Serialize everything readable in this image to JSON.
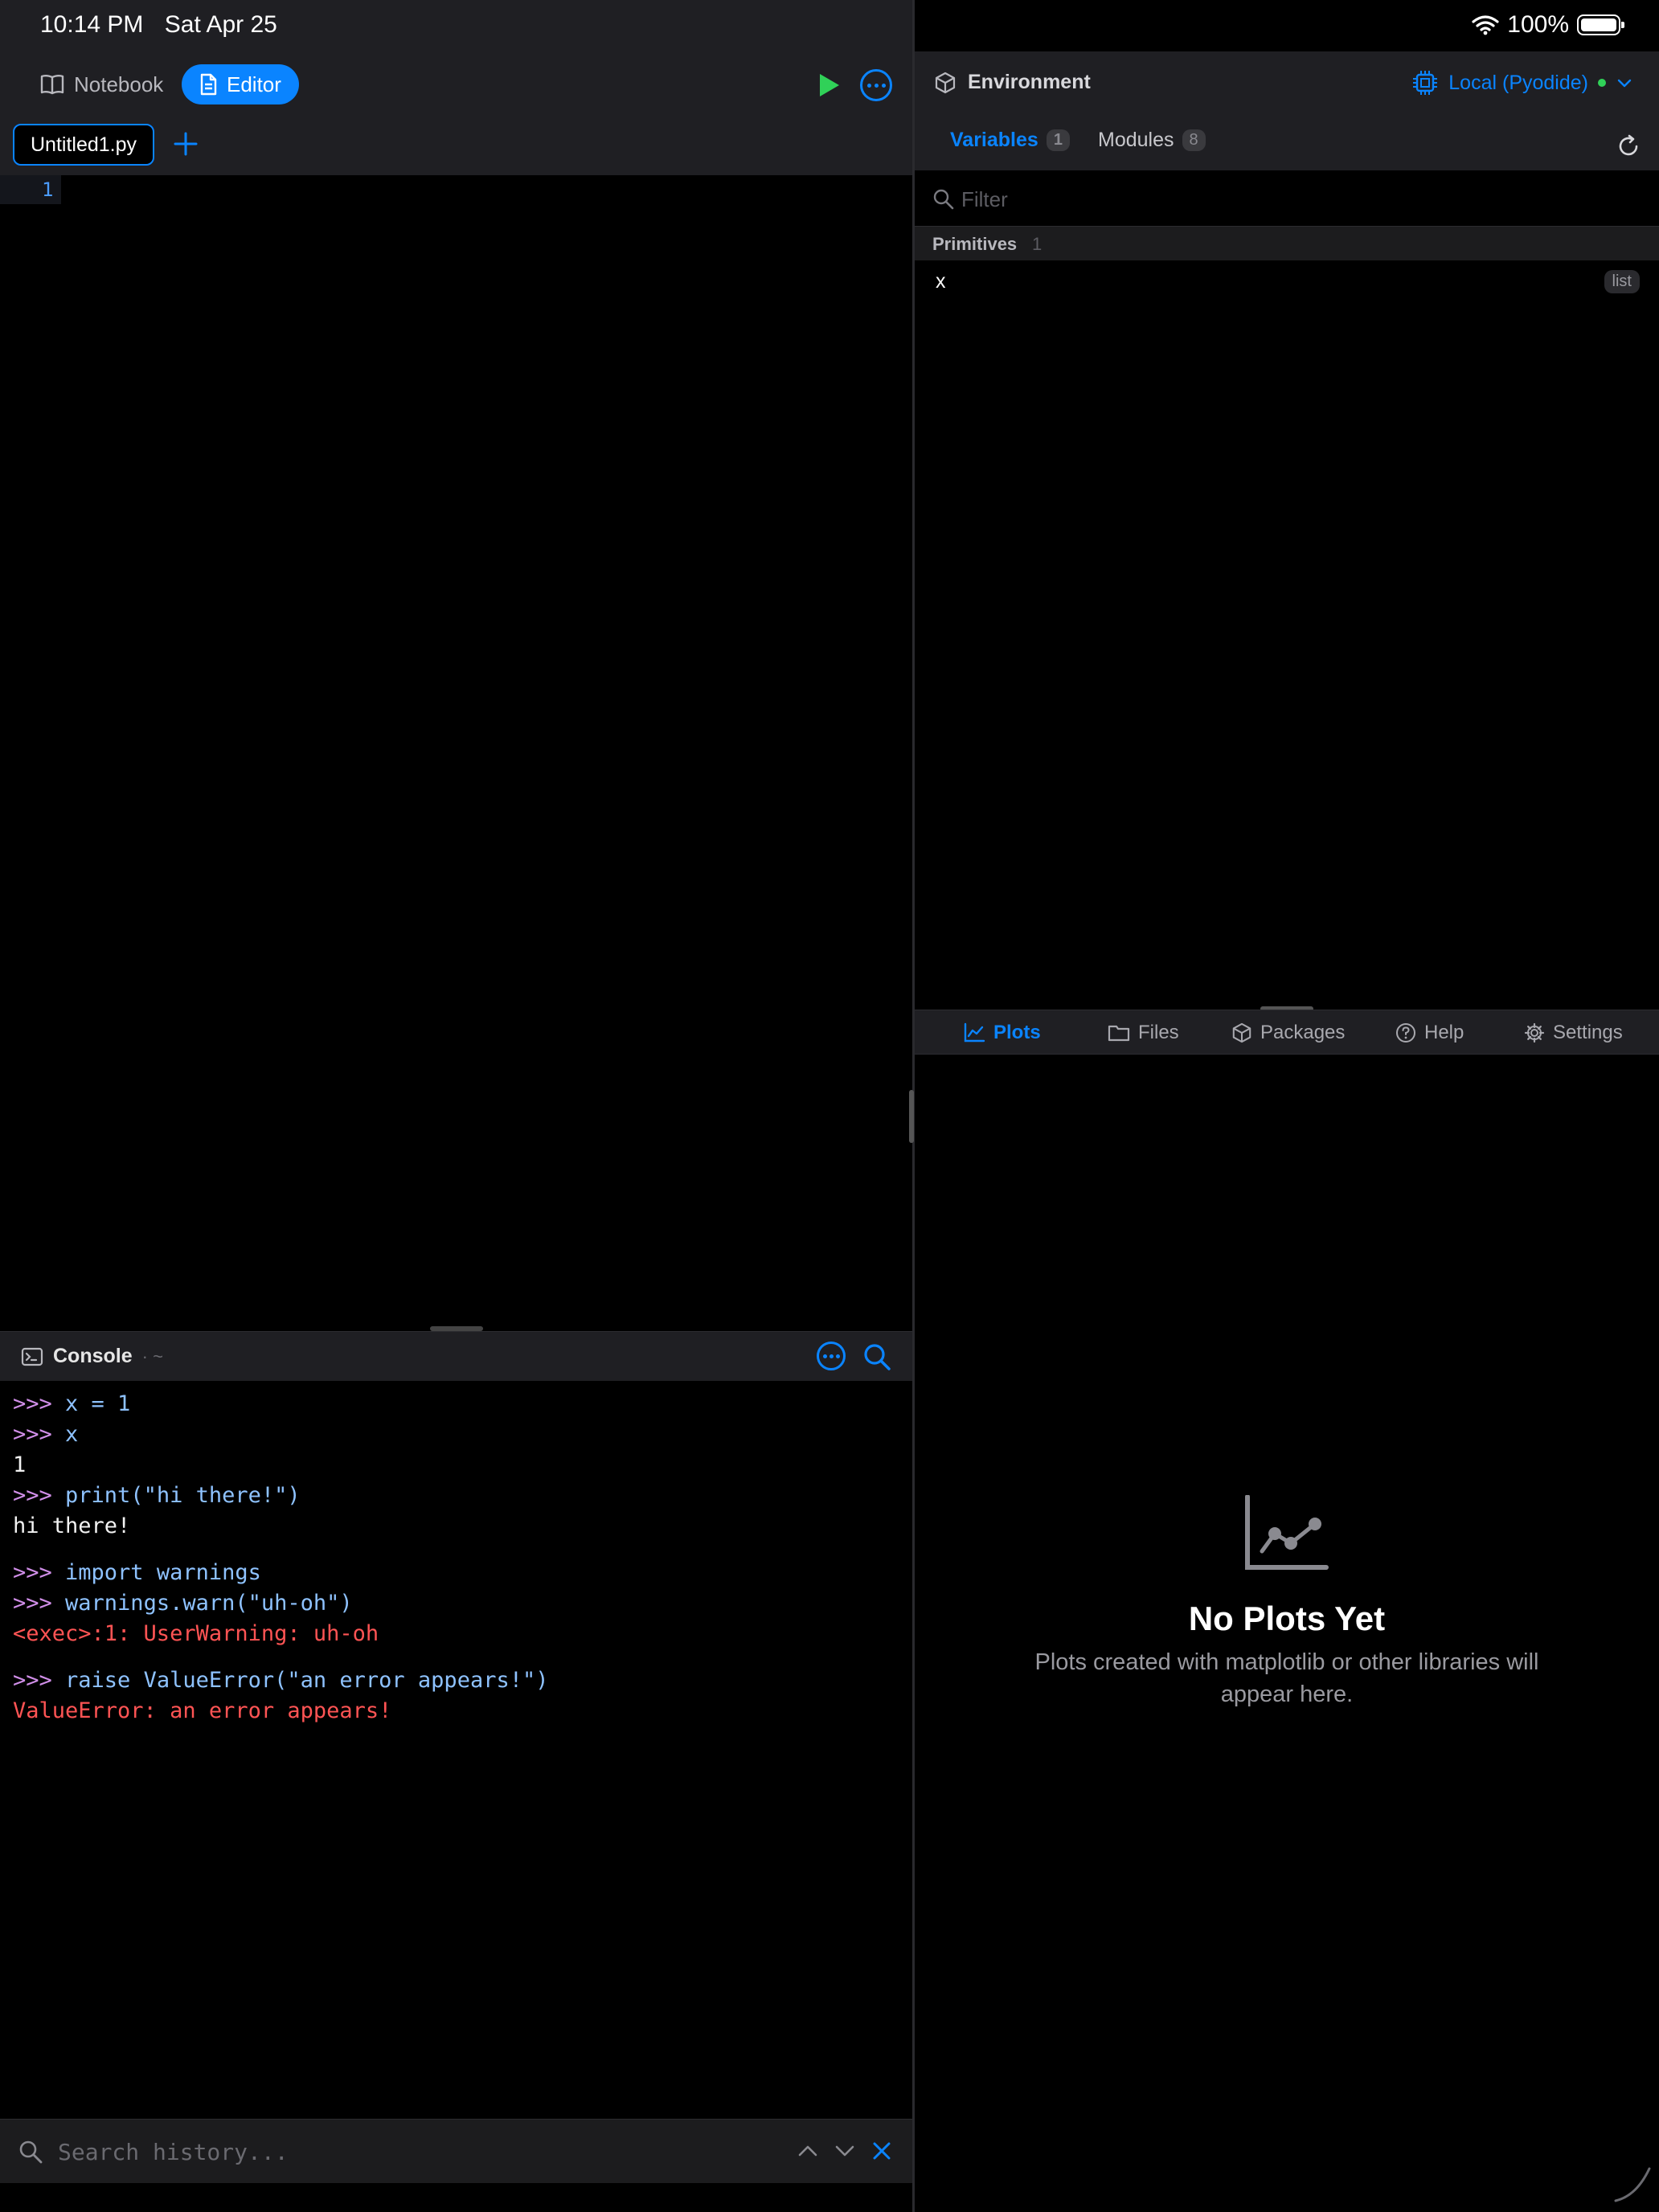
{
  "status": {
    "time": "10:14 PM",
    "date": "Sat Apr 25",
    "battery": "100%"
  },
  "modes": {
    "notebook_label": "Notebook",
    "editor_label": "Editor"
  },
  "editor": {
    "active_tab": "Untitled1.py",
    "line_numbers": [
      "1"
    ]
  },
  "console": {
    "title": "Console",
    "subtitle": "· ~",
    "lines": [
      {
        "prompt": ">>> ",
        "code": "x = 1"
      },
      {
        "prompt": ">>> ",
        "code": "x"
      },
      {
        "out": "1"
      },
      {
        "prompt": ">>> ",
        "code": "print(\"hi there!\")"
      },
      {
        "out": "hi there!"
      },
      {
        "gap": true
      },
      {
        "prompt": ">>> ",
        "code": "import warnings"
      },
      {
        "prompt": ">>> ",
        "code": "warnings.warn(\"uh-oh\")"
      },
      {
        "err": "<exec>:1: UserWarning: uh-oh"
      },
      {
        "gap": true
      },
      {
        "prompt": ">>> ",
        "code": "raise ValueError(\"an error appears!\")"
      },
      {
        "err": "ValueError: an error appears!"
      }
    ],
    "history_placeholder": "Search history..."
  },
  "environment": {
    "title": "Environment",
    "kernel": "Local (Pyodide)",
    "tabs": {
      "variables_label": "Variables",
      "variables_count": "1",
      "modules_label": "Modules",
      "modules_count": "8"
    },
    "filter_placeholder": "Filter",
    "section": {
      "label": "Primitives",
      "count": "1"
    },
    "variables": [
      {
        "name": "x",
        "type": "list"
      }
    ]
  },
  "tools": {
    "plots": "Plots",
    "files": "Files",
    "packages": "Packages",
    "help": "Help",
    "settings": "Settings"
  },
  "plots_empty": {
    "title": "No Plots Yet",
    "description": "Plots created with matplotlib or other libraries will appear here."
  },
  "colors": {
    "accent": "#0a84ff",
    "run": "#30d158",
    "prompt": "#d08ee8",
    "code": "#8ec2ff",
    "error": "#ff5454"
  }
}
